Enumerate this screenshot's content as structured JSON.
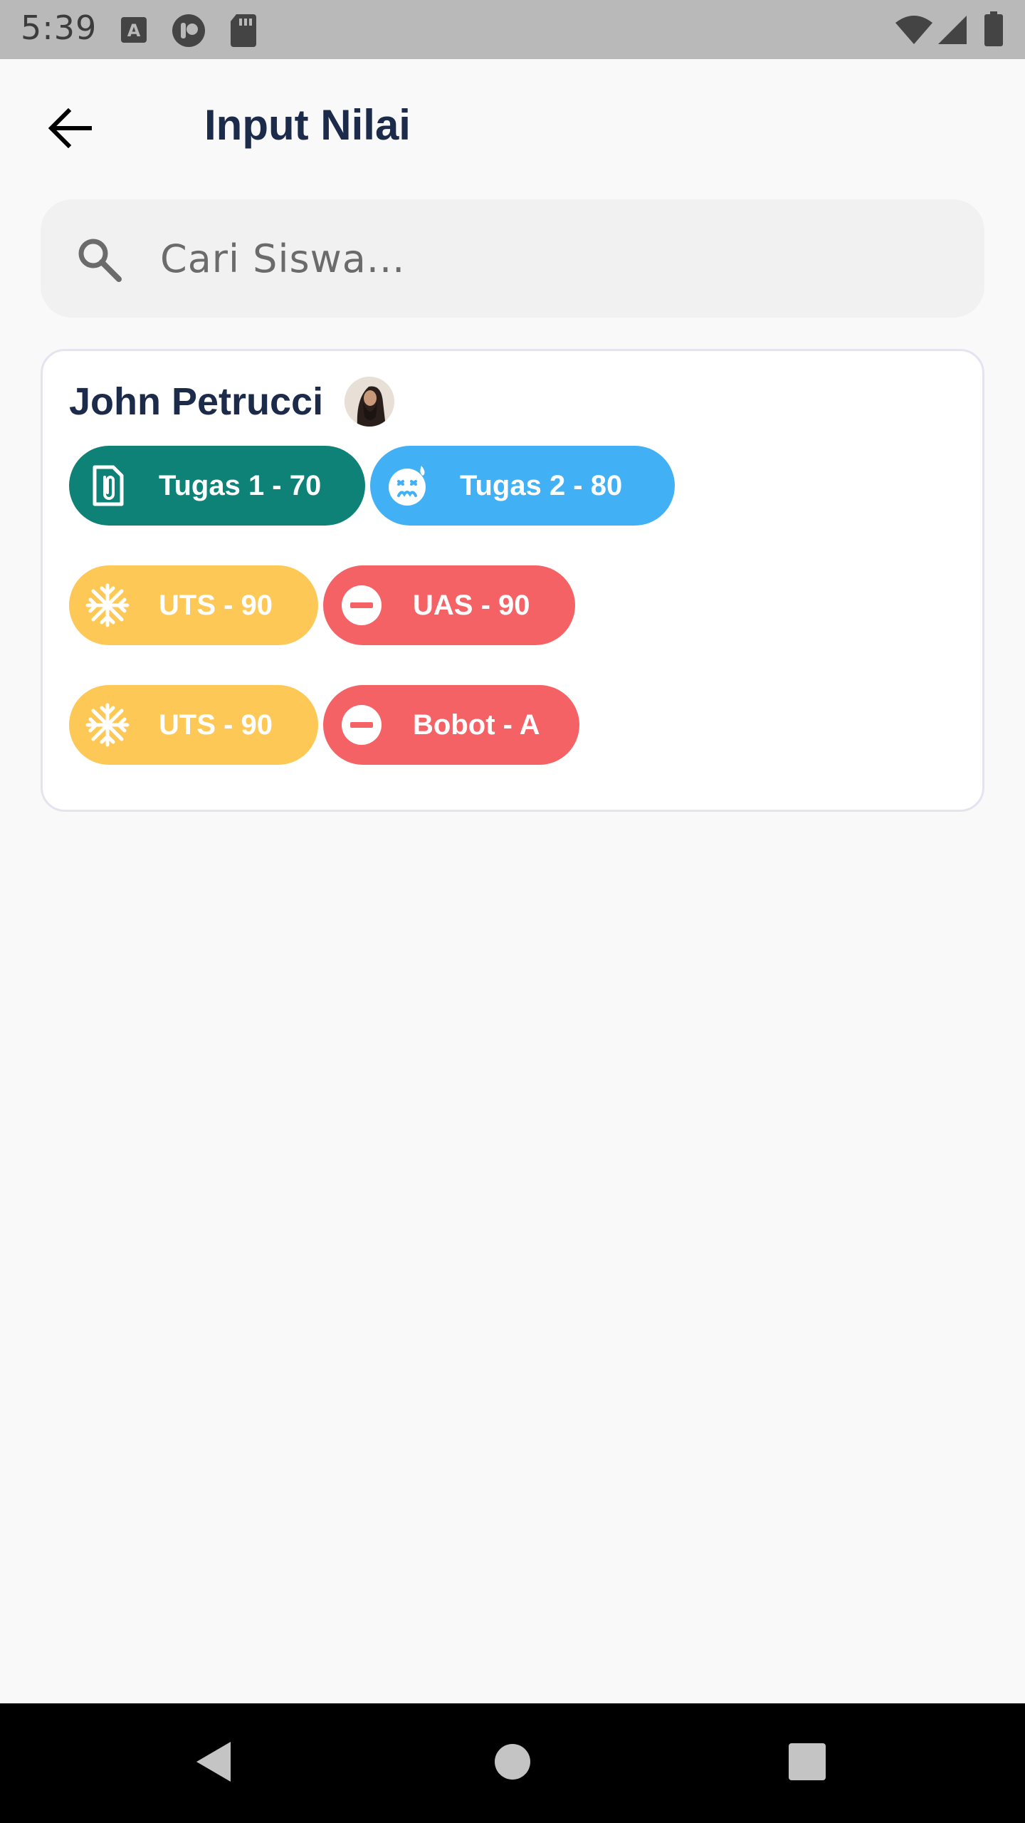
{
  "status_bar": {
    "time": "5:39",
    "left_icons": [
      "font-a-icon",
      "assistant-icon",
      "sd-card-icon"
    ],
    "right_icons": [
      "wifi-icon",
      "signal-icon",
      "battery-icon"
    ]
  },
  "header": {
    "title": "Input Nilai",
    "back_icon": "arrow-left-icon"
  },
  "search": {
    "placeholder": "Cari Siswa...",
    "value": "",
    "icon": "search-icon"
  },
  "students": [
    {
      "name": "John Petrucci",
      "avatar": "avatar",
      "chips": [
        {
          "label": "Tugas 1 - 70",
          "icon": "clipboard-icon",
          "color": "#0f8278"
        },
        {
          "label": "Tugas 2 - 80",
          "icon": "sad-sweat-face-icon",
          "color": "#42b0f5"
        },
        {
          "label": "UTS - 90",
          "icon": "snowflake-icon",
          "color": "#fdc855"
        },
        {
          "label": "UAS - 90",
          "icon": "minus-circle-icon",
          "color": "#f46265"
        },
        {
          "label": "UTS - 90",
          "icon": "snowflake-icon",
          "color": "#fdc855"
        },
        {
          "label": "Bobot - A",
          "icon": "minus-circle-icon",
          "color": "#f46265"
        }
      ]
    }
  ],
  "nav_bar": {
    "buttons": [
      "back-triangle-icon",
      "home-circle-icon",
      "recents-square-icon"
    ]
  }
}
